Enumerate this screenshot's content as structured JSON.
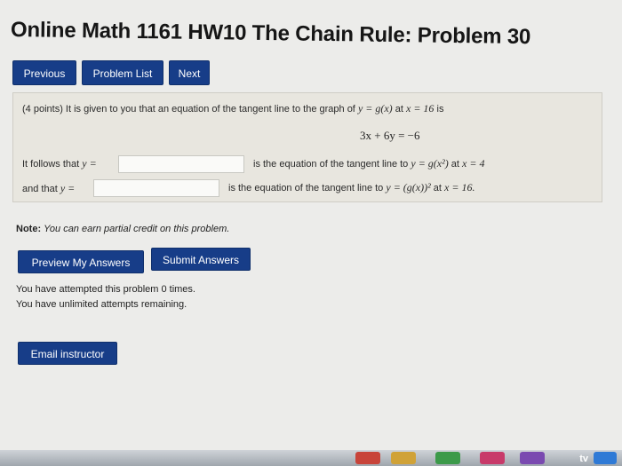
{
  "page": {
    "title": "Online Math 1161 HW10 The Chain Rule: Problem 30"
  },
  "nav": {
    "previous": "Previous",
    "problem_list": "Problem List",
    "next": "Next"
  },
  "problem": {
    "points": "(4 points) It is given to you that an equation of the tangent line to the graph of",
    "y_eq_gx": "y = g(x)",
    "at_x": "at",
    "x_eq_16": "x = 16",
    "is": "is",
    "tangent_equation": "3x + 6y = −6",
    "row1_prefix": "It follows that",
    "row1_var": "y =",
    "row1_suffix": "is the equation of the tangent line to",
    "row1_func": "y = g(x²)",
    "row1_at": "at",
    "row1_point": "x = 4",
    "row2_prefix": "and that",
    "row2_var": "y =",
    "row2_suffix": "is the equation of the tangent line to",
    "row2_func": "y = (g(x))²",
    "row2_at": "at",
    "row2_point": "x = 16.",
    "answer1_value": "",
    "answer2_value": ""
  },
  "note": {
    "label": "Note:",
    "text": "You can earn partial credit on this problem."
  },
  "actions": {
    "preview": "Preview My Answers",
    "submit": "Submit Answers",
    "email": "Email instructor"
  },
  "attempts": {
    "line1": "You have attempted this problem 0 times.",
    "line2": "You have unlimited attempts remaining."
  },
  "dock": {
    "tv_label": "tv"
  },
  "colors": {
    "button_blue": "#173d88",
    "page_bg": "#ececea",
    "box_bg": "#e8e6df"
  }
}
